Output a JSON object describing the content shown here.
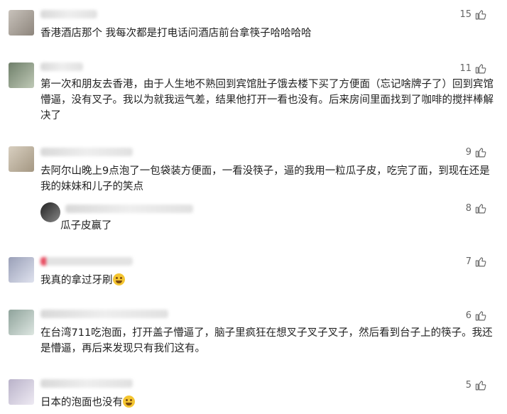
{
  "comments": [
    {
      "likes": "15",
      "text": "香港酒店那个 我每次都是打电话问酒店前台拿筷子哈哈哈哈"
    },
    {
      "likes": "11",
      "text": "第一次和朋友去香港，由于人生地不熟回到宾馆肚子饿去楼下买了方便面（忘记啥牌子了）回到宾馆懵逼，没有叉子。我以为就我运气差，结果他打开一看也没有。后来房间里面找到了咖啡的搅拌棒解决了"
    },
    {
      "likes": "9",
      "text": "去阿尔山晚上9点泡了一包袋装方便面，一看没筷子，逼的我用一粒瓜子皮，吃完了面，到现在还是我的妹妹和儿子的笑点"
    },
    {
      "likes": "8",
      "text": "瓜子皮赢了"
    },
    {
      "likes": "7",
      "text": "我真的拿过牙刷",
      "emoji": "sweat-face-icon"
    },
    {
      "likes": "6",
      "text": "在台湾711吃泡面，打开盖子懵逼了，脑子里疯狂在想叉子叉子叉子，然后看到台子上的筷子。我还是懵逼，再后来发现只有我们这有。"
    },
    {
      "likes": "5",
      "text": "日本的泡面也没有",
      "emoji": "laughing-face-icon"
    }
  ]
}
